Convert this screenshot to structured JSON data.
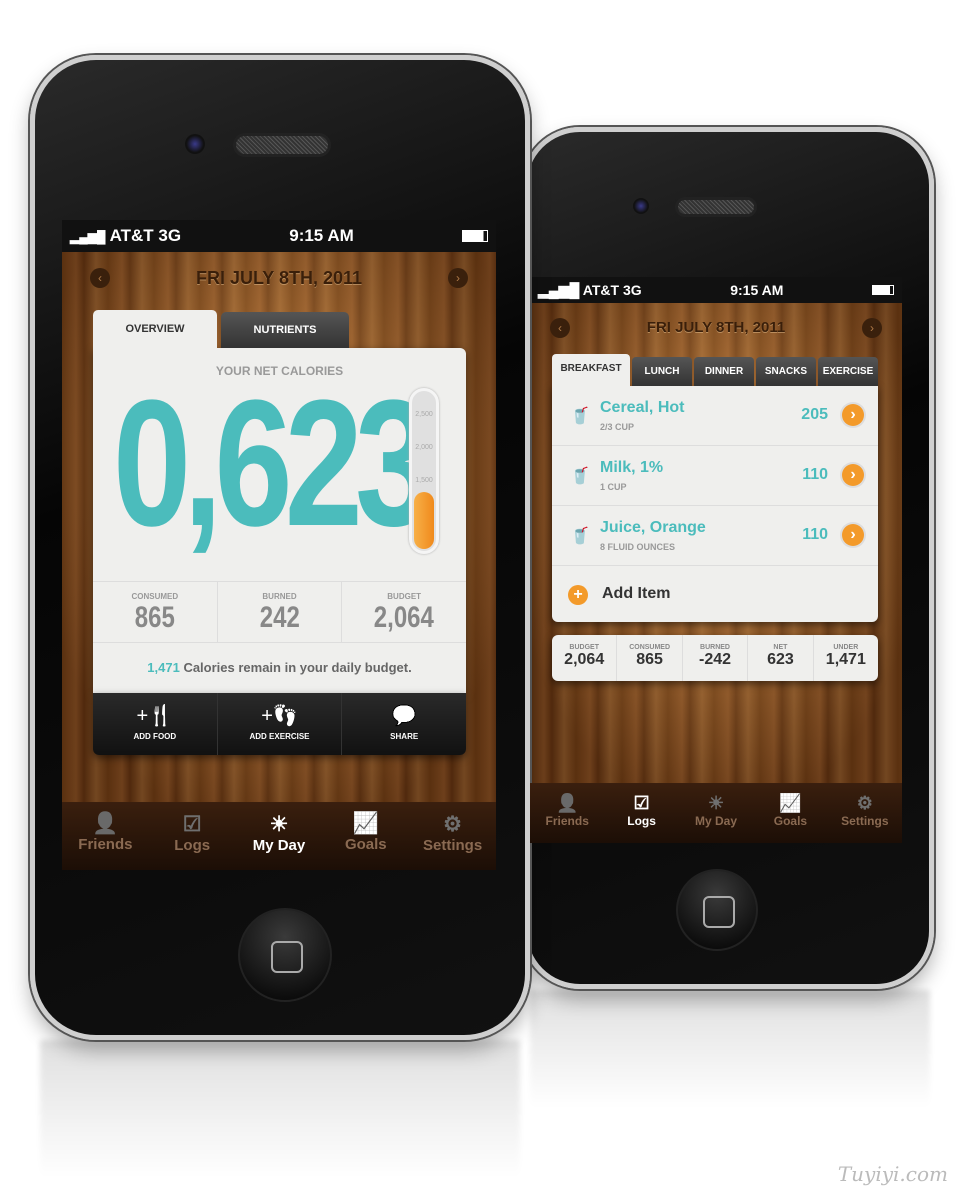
{
  "left_phone": {
    "status": {
      "carrier": "AT&T",
      "network": "3G",
      "time": "9:15 AM"
    },
    "date": "FRI JULY 8TH, 2011",
    "tabs": [
      {
        "label": "OVERVIEW",
        "active": true
      },
      {
        "label": "NUTRIENTS",
        "active": false
      }
    ],
    "net_label": "YOUR NET CALORIES",
    "net_value": "0,623",
    "gauge": {
      "ticks": [
        "2,500",
        "2,000",
        "1,500"
      ],
      "fill_value": 623
    },
    "stats": [
      {
        "label": "CONSUMED",
        "value": "865"
      },
      {
        "label": "BURNED",
        "value": "242"
      },
      {
        "label": "BUDGET",
        "value": "2,064"
      }
    ],
    "remain_number": "1,471",
    "remain_text": " Calories remain in your daily budget.",
    "actions": [
      {
        "label": "ADD FOOD",
        "icon": "fork-knife-plus-icon"
      },
      {
        "label": "ADD EXERCISE",
        "icon": "footprints-plus-icon"
      },
      {
        "label": "SHARE",
        "icon": "speech-bubbles-icon"
      }
    ],
    "nav": [
      {
        "label": "Friends",
        "icon": "person-icon"
      },
      {
        "label": "Logs",
        "icon": "calendar-check-icon"
      },
      {
        "label": "My Day",
        "icon": "sun-icon",
        "active": true
      },
      {
        "label": "Goals",
        "icon": "chart-icon"
      },
      {
        "label": "Settings",
        "icon": "gear-icon"
      }
    ]
  },
  "right_phone": {
    "status": {
      "carrier": "AT&T",
      "network": "3G",
      "time": "9:15 AM"
    },
    "date": "FRI JULY 8TH, 2011",
    "tabs": [
      {
        "label": "BREAKFAST",
        "active": true
      },
      {
        "label": "LUNCH"
      },
      {
        "label": "DINNER"
      },
      {
        "label": "SNACKS"
      },
      {
        "label": "EXERCISE"
      }
    ],
    "items": [
      {
        "name": "Cereal, Hot",
        "qty": "2/3 CUP",
        "cal": "205"
      },
      {
        "name": "Milk, 1%",
        "qty": "1 CUP",
        "cal": "110"
      },
      {
        "name": "Juice, Orange",
        "qty": "8 FLUID OUNCES",
        "cal": "110"
      }
    ],
    "add_item": "Add Item",
    "summary": [
      {
        "label": "BUDGET",
        "value": "2,064"
      },
      {
        "label": "CONSUMED",
        "value": "865"
      },
      {
        "label": "BURNED",
        "value": "-242"
      },
      {
        "label": "NET",
        "value": "623"
      },
      {
        "label": "UNDER",
        "value": "1,471"
      }
    ],
    "nav": [
      {
        "label": "Friends",
        "icon": "person-icon"
      },
      {
        "label": "Logs",
        "icon": "calendar-check-icon",
        "active": true
      },
      {
        "label": "My Day",
        "icon": "sun-icon"
      },
      {
        "label": "Goals",
        "icon": "chart-icon"
      },
      {
        "label": "Settings",
        "icon": "gear-icon"
      }
    ]
  },
  "watermark": "Tuyiyi.com",
  "colors": {
    "teal": "#4bbcbc",
    "orange": "#f39a2a",
    "wood": "#8a4a18"
  }
}
